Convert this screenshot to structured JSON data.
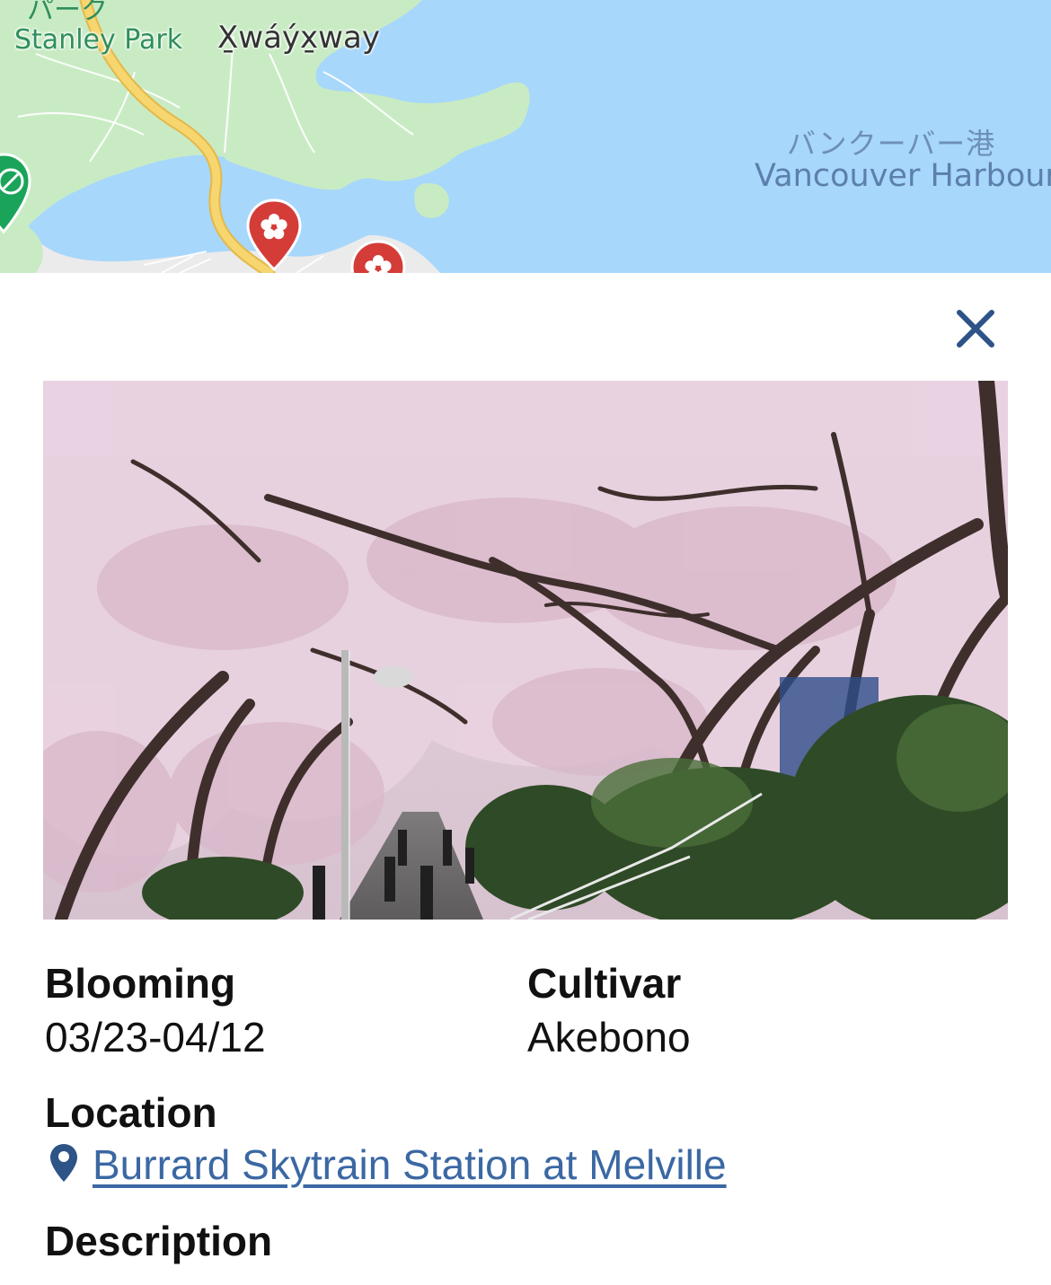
{
  "map": {
    "labels": {
      "park_jp": "パーク",
      "park": "Stanley Park",
      "xwayxway": "X̱wáýx̱way",
      "harbour_jp": "バンクーバー港",
      "harbour": "Vancouver Harbour"
    },
    "colors": {
      "water": "#a7d7fb",
      "land": "#c9ebc4",
      "road": "#f7d66f",
      "pin": "#d43c38"
    },
    "markers": [
      "cherry-blossom-pin-icon",
      "cherry-blossom-pin-icon",
      "park-pin-icon"
    ]
  },
  "sheet": {
    "close_icon": "close-icon",
    "photo_alt": "Cherry blossom trees over a walkway",
    "blooming": {
      "label": "Blooming",
      "value": "03/23-04/12"
    },
    "cultivar": {
      "label": "Cultivar",
      "value": "Akebono"
    },
    "location": {
      "label": "Location",
      "value": "Burrard Skytrain Station at Melville",
      "icon": "location-pin-icon"
    },
    "description": {
      "label": "Description"
    }
  }
}
